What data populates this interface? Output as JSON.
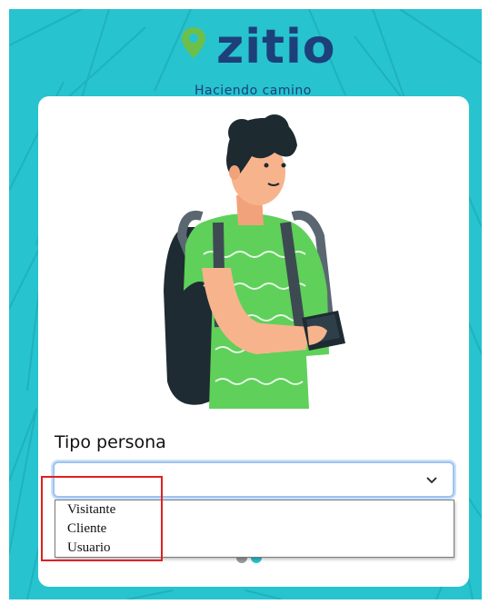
{
  "logo": {
    "name": "zitio",
    "tagline": "Haciendo camino"
  },
  "form": {
    "label": "Tipo persona",
    "selected": "",
    "options": [
      "Visitante",
      "Cliente",
      "Usuario"
    ]
  },
  "pager": {
    "total": 2,
    "active": 2
  },
  "colors": {
    "background": "#27c3cf",
    "brand": "#1d3f7a",
    "pin": "#6cc04a",
    "dot_inactive": "#9a9a9a",
    "dot_active": "#27c3cf",
    "annotation": "#e02020"
  },
  "icons": [
    "location-pin-icon",
    "chevron-down-icon"
  ]
}
